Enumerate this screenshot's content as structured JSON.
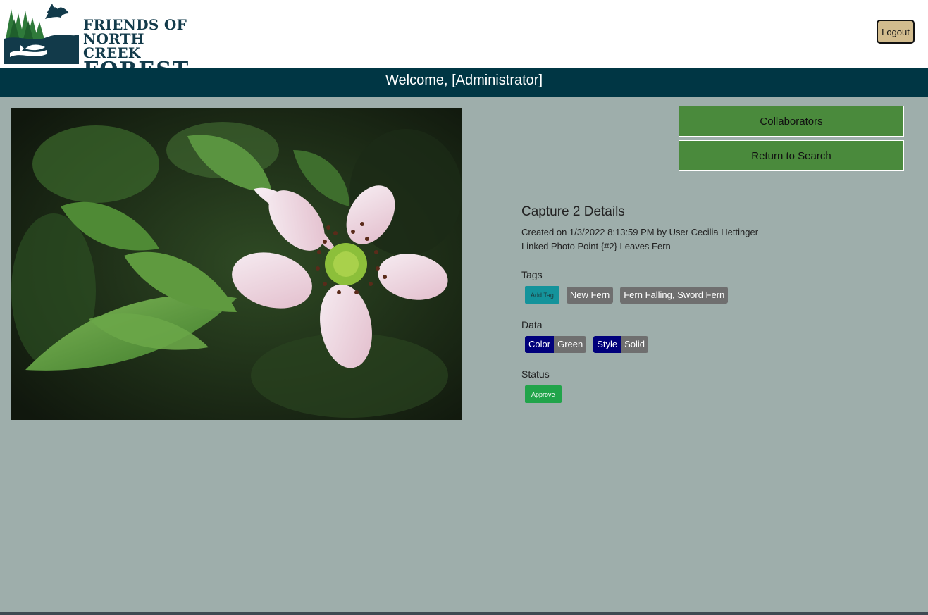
{
  "header": {
    "logo_lines": [
      "FRIENDS OF",
      "NORTH CREEK",
      "FOREST"
    ],
    "logout_label": "Logout"
  },
  "banner": {
    "welcome_text": "Welcome, [Administrator]"
  },
  "actions": {
    "collaborators_label": "Collaborators",
    "return_label": "Return to Search"
  },
  "details": {
    "title": "Capture 2 Details",
    "created_line": "Created on 1/3/2022 8:13:59 PM by User Cecilia Hettinger",
    "linked_line": "Linked Photo Point {#2} Leaves Fern",
    "tags_label": "Tags",
    "add_tag_label": "Add Tag",
    "tags": [
      "New Fern",
      "Fern Falling, Sword Fern"
    ],
    "data_label": "Data",
    "data": [
      {
        "key": "Color",
        "value": "Green"
      },
      {
        "key": "Style",
        "value": "Solid"
      }
    ],
    "status_label": "Status",
    "approve_label": "Approve"
  },
  "colors": {
    "background": "#9eaeab",
    "banner": "#003644",
    "button_green": "#4a8a3c",
    "logout": "#d2bc8e",
    "chip_gray": "#6f6f6f",
    "data_key": "#00007b",
    "add_tag": "#14939b",
    "approve": "#21a44a"
  },
  "icons": {
    "logo": "forest-bird-fish-logo-icon"
  }
}
